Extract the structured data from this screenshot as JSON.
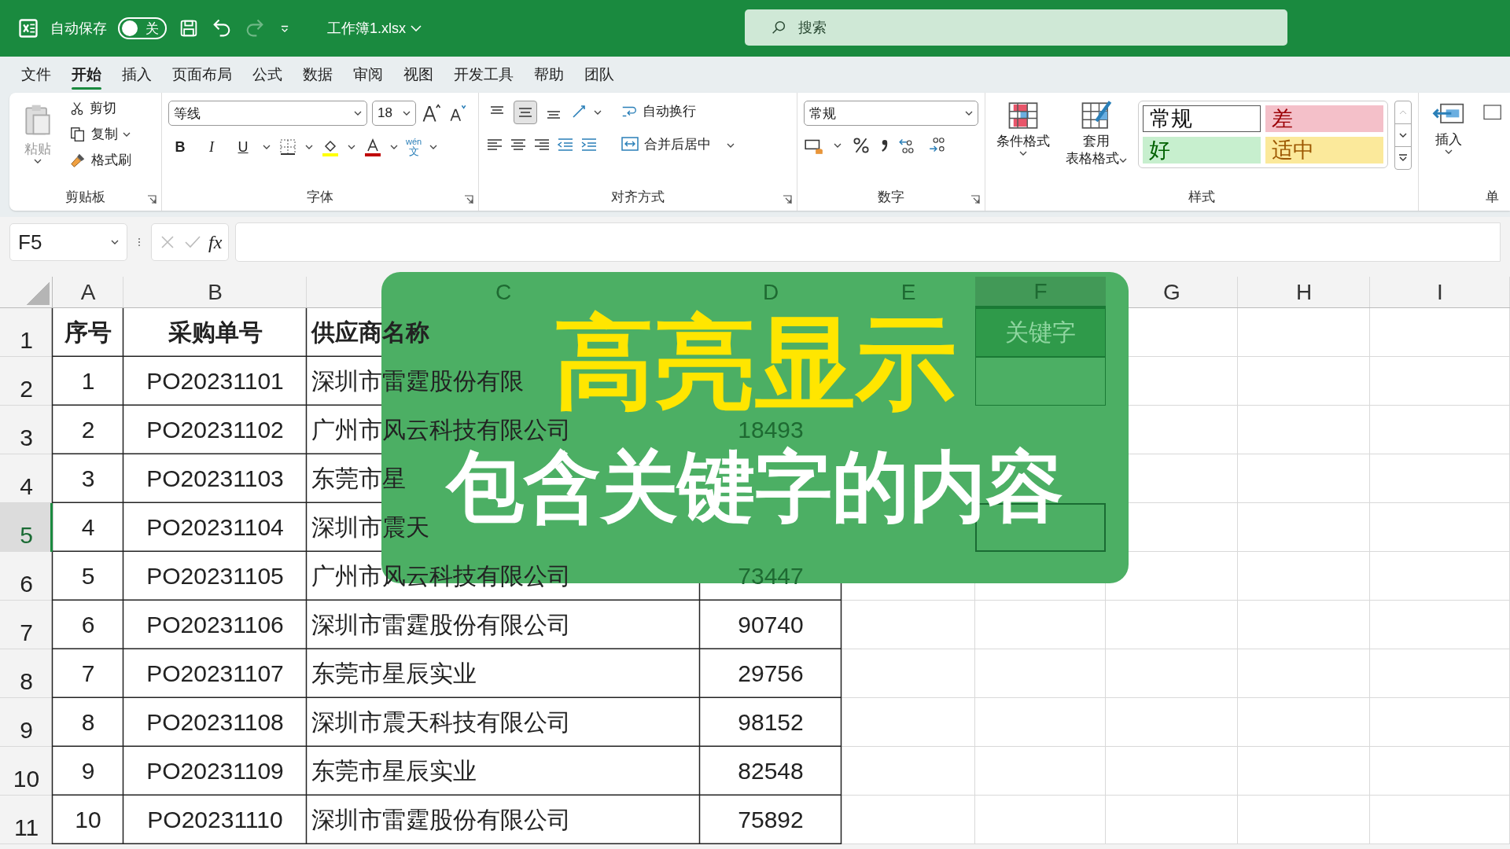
{
  "title_bar": {
    "autosave_label": "自动保存",
    "autosave_toggle": {
      "label": "关",
      "on": false
    },
    "filename": "工作簿1.xlsx",
    "search_placeholder": "搜索"
  },
  "menu_tabs": [
    {
      "label": "文件",
      "selected": false
    },
    {
      "label": "开始",
      "selected": true
    },
    {
      "label": "插入",
      "selected": false
    },
    {
      "label": "页面布局",
      "selected": false
    },
    {
      "label": "公式",
      "selected": false
    },
    {
      "label": "数据",
      "selected": false
    },
    {
      "label": "审阅",
      "selected": false
    },
    {
      "label": "视图",
      "selected": false
    },
    {
      "label": "开发工具",
      "selected": false
    },
    {
      "label": "帮助",
      "selected": false
    },
    {
      "label": "团队",
      "selected": false
    }
  ],
  "ribbon": {
    "clipboard": {
      "paste": "粘贴",
      "cut": "剪切",
      "copy": "复制",
      "format_painter": "格式刷",
      "group": "剪贴板"
    },
    "font": {
      "name": "等线",
      "size": "18",
      "bold": "B",
      "italic": "I",
      "underline": "U",
      "phonetic_top": "wén",
      "phonetic_bottom": "文",
      "group": "字体"
    },
    "alignment": {
      "vertical": [
        {
          "selected": false
        },
        {
          "selected": true
        },
        {
          "selected": false
        }
      ],
      "wrap": "自动换行",
      "merge": "合并后居中",
      "group": "对齐方式"
    },
    "number": {
      "format": "常规",
      "group": "数字"
    },
    "styles": {
      "conditional": "条件格式",
      "table_top": "套用",
      "table_bottom": "表格格式",
      "cells": [
        {
          "label": "常规",
          "kind": "normal"
        },
        {
          "label": "差",
          "kind": "bad"
        },
        {
          "label": "好",
          "kind": "good"
        },
        {
          "label": "适中",
          "kind": "neutral"
        }
      ],
      "group": "样式"
    },
    "cells": {
      "insert": "插入",
      "group_partial": "单"
    }
  },
  "formula_bar": {
    "name_box": "F5",
    "fx": "fx"
  },
  "sheet": {
    "columns": [
      {
        "label": "A",
        "selected": false
      },
      {
        "label": "B",
        "selected": false
      },
      {
        "label": "C",
        "selected": false
      },
      {
        "label": "D",
        "selected": false
      },
      {
        "label": "E",
        "selected": false
      },
      {
        "label": "F",
        "selected": true
      },
      {
        "label": "G",
        "selected": false
      },
      {
        "label": "H",
        "selected": false
      },
      {
        "label": "I",
        "selected": false
      }
    ],
    "rows": [
      {
        "number": "1",
        "selected": false,
        "cells": [
          "序号",
          "采购单号",
          "供应商名称",
          null
        ]
      },
      {
        "number": "2",
        "selected": false,
        "cells": [
          "1",
          "PO20231101",
          "深圳市雷霆股份有限",
          null
        ]
      },
      {
        "number": "3",
        "selected": false,
        "cells": [
          "2",
          "PO20231102",
          "广州市风云科技有限公司",
          "18493"
        ]
      },
      {
        "number": "4",
        "selected": false,
        "cells": [
          "3",
          "PO20231103",
          "东莞市星",
          null
        ]
      },
      {
        "number": "5",
        "selected": true,
        "cells": [
          "4",
          "PO20231104",
          "深圳市震天",
          null
        ]
      },
      {
        "number": "6",
        "selected": false,
        "cells": [
          "5",
          "PO20231105",
          "广州市风云科技有限公司",
          "73447"
        ]
      },
      {
        "number": "7",
        "selected": false,
        "cells": [
          "6",
          "PO20231106",
          "深圳市雷霆股份有限公司",
          "90740"
        ]
      },
      {
        "number": "8",
        "selected": false,
        "cells": [
          "7",
          "PO20231107",
          "东莞市星辰实业",
          "29756"
        ]
      },
      {
        "number": "9",
        "selected": false,
        "cells": [
          "8",
          "PO20231108",
          "深圳市震天科技有限公司",
          "98152"
        ]
      },
      {
        "number": "10",
        "selected": false,
        "cells": [
          "9",
          "PO20231109",
          "东莞市星辰实业",
          "82548"
        ]
      },
      {
        "number": "11",
        "selected": false,
        "cells": [
          "10",
          "PO20231110",
          "深圳市雷霆股份有限公司",
          "75892"
        ]
      }
    ],
    "keyword_cell": "关键字"
  },
  "overlay": {
    "title": "高亮显示",
    "subtitle": "包含关键字的内容"
  }
}
